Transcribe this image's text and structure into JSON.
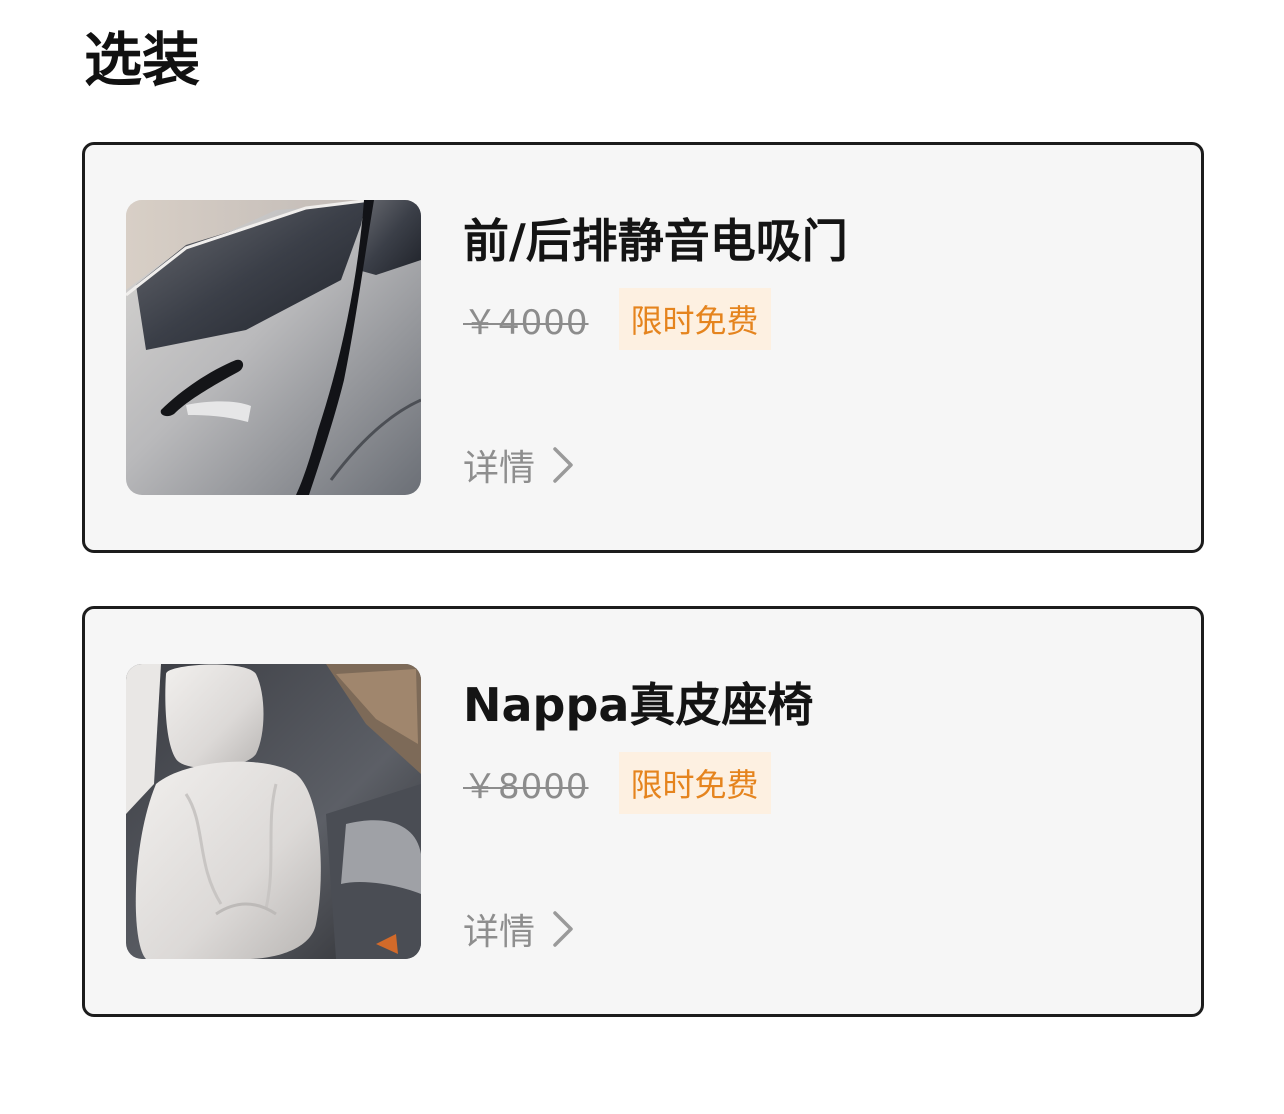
{
  "page": {
    "title": "选装"
  },
  "options": [
    {
      "name": "前/后排静音电吸门",
      "original_price": "￥4000",
      "badge": "限时免费",
      "detail_label": "详情",
      "image_icon": "car-door-photo"
    },
    {
      "name": "Nappa真皮座椅",
      "original_price": "￥8000",
      "badge": "限时免费",
      "detail_label": "详情",
      "image_icon": "leather-seat-photo"
    }
  ],
  "colors": {
    "card_background": "#f6f6f6",
    "card_border": "#1c1c1c",
    "badge_background": "#fdf0e1",
    "badge_text": "#e5841e",
    "muted_text": "#8e8e8e"
  }
}
